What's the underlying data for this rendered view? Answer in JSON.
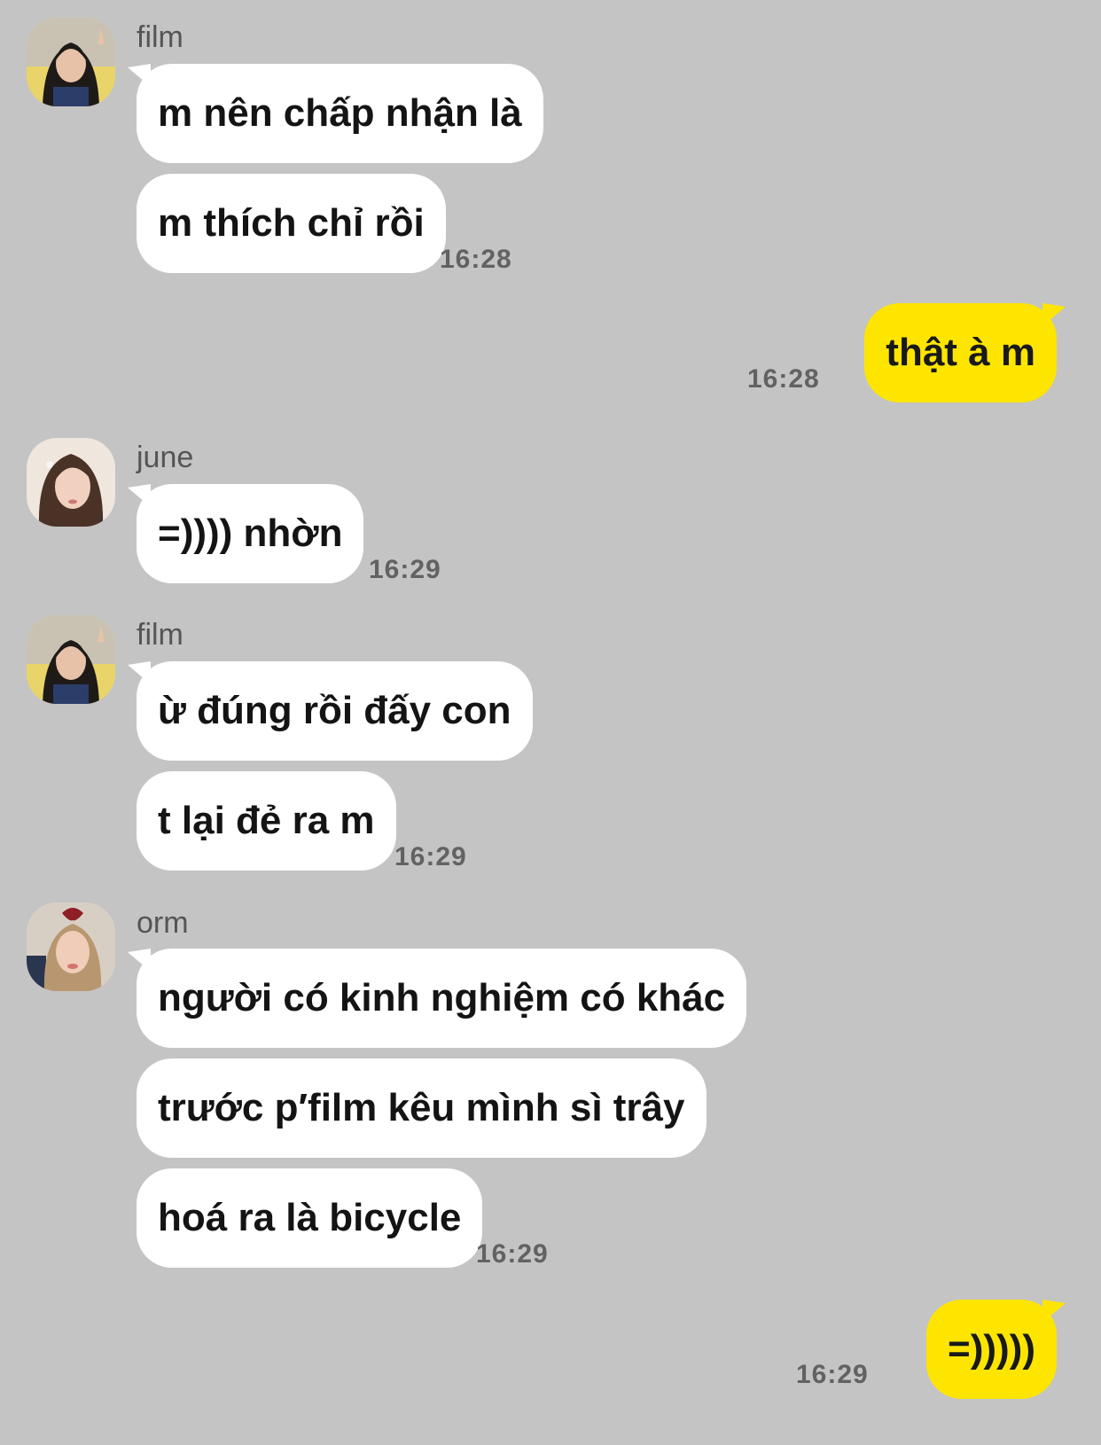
{
  "conversation": {
    "groups": [
      {
        "sender": "film",
        "messages": [
          "m nên chấp nhận là",
          "m thích chỉ rồi"
        ],
        "time": "16:28"
      },
      {
        "outgoing_message": "thật à m",
        "time": "16:28"
      },
      {
        "sender": "june",
        "messages": [
          "=)))) nhờn"
        ],
        "time": "16:29"
      },
      {
        "sender": "film",
        "messages": [
          "ừ đúng rồi đấy con",
          "t lại đẻ ra m"
        ],
        "time": "16:29"
      },
      {
        "sender": "orm",
        "messages": [
          "người có kinh nghiệm có khác",
          "trước p′film kêu mình sì trây",
          "hoá ra là bicycle"
        ],
        "time": "16:29"
      },
      {
        "outgoing_message": "=)))))",
        "time": "16:29"
      }
    ]
  },
  "colors": {
    "background": "#c4c4c4",
    "incoming_bubble": "#ffffff",
    "outgoing_bubble": "#fee500"
  }
}
